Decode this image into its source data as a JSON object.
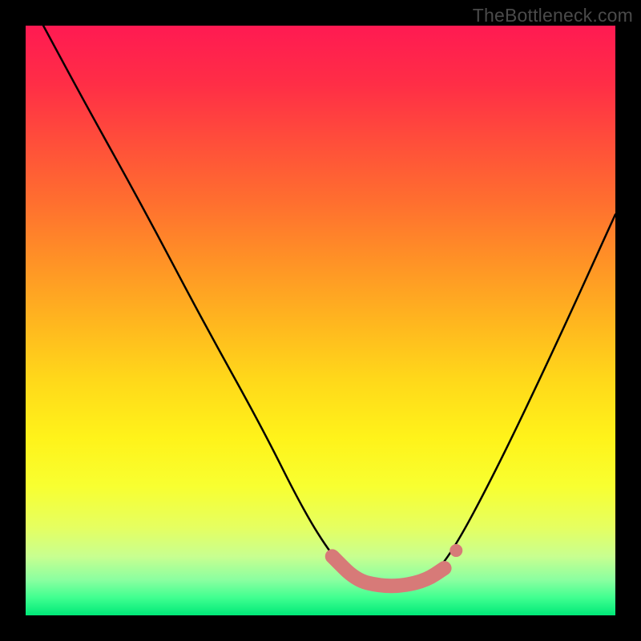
{
  "watermark": "TheBottleneck.com",
  "gradient": {
    "stops": [
      {
        "offset": 0.0,
        "color": "#ff1a52"
      },
      {
        "offset": 0.1,
        "color": "#ff2e46"
      },
      {
        "offset": 0.2,
        "color": "#ff4f3a"
      },
      {
        "offset": 0.3,
        "color": "#ff6f2f"
      },
      {
        "offset": 0.4,
        "color": "#ff9226"
      },
      {
        "offset": 0.5,
        "color": "#ffb51f"
      },
      {
        "offset": 0.6,
        "color": "#ffd81a"
      },
      {
        "offset": 0.7,
        "color": "#fff31a"
      },
      {
        "offset": 0.78,
        "color": "#f8ff30"
      },
      {
        "offset": 0.85,
        "color": "#e6ff60"
      },
      {
        "offset": 0.9,
        "color": "#c8ff90"
      },
      {
        "offset": 0.94,
        "color": "#8affa0"
      },
      {
        "offset": 0.97,
        "color": "#40ff90"
      },
      {
        "offset": 1.0,
        "color": "#00e878"
      }
    ]
  },
  "chart_data": {
    "type": "line",
    "title": "",
    "xlabel": "",
    "ylabel": "",
    "xlim": [
      0,
      100
    ],
    "ylim": [
      0,
      100
    ],
    "series": [
      {
        "name": "curve",
        "x": [
          3,
          10,
          20,
          30,
          40,
          47,
          52,
          56,
          60,
          64,
          68,
          72,
          80,
          90,
          100
        ],
        "y": [
          100,
          87,
          69,
          50,
          32,
          18,
          10,
          6,
          5,
          5,
          6,
          10,
          25,
          46,
          68
        ]
      }
    ],
    "highlight_segment": {
      "color": "#d77a78",
      "x": [
        52,
        56,
        60,
        64,
        68,
        71
      ],
      "y": [
        10,
        6,
        5,
        5,
        6,
        8
      ]
    },
    "highlight_dot": {
      "x": 73,
      "y": 11,
      "color": "#d77a78"
    }
  }
}
